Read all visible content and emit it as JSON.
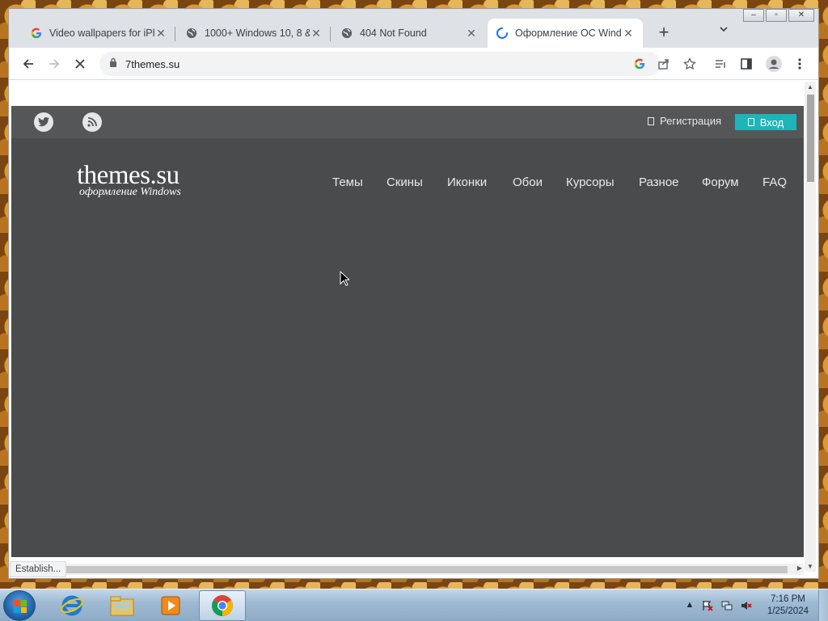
{
  "browser": {
    "tabs": [
      {
        "title": "Video wallpapers for iPh",
        "favicon": "google-g-icon",
        "active": false
      },
      {
        "title": "1000+ Windows 10, 8 &",
        "favicon": "globe-icon",
        "active": false
      },
      {
        "title": "404 Not Found",
        "favicon": "globe-icon",
        "active": false
      },
      {
        "title": "Оформление ОС Windo",
        "favicon": "loading-spinner-icon",
        "active": true
      }
    ],
    "new_tab_label": "+",
    "address": "7themes.su",
    "status_text": "Establish..."
  },
  "site": {
    "register_label": "Регистрация",
    "login_label": "Вход",
    "logo_main": "themes.su",
    "logo_sub": "оформление Windows",
    "nav": [
      "Темы",
      "Скины",
      "Иконки",
      "Обои",
      "Курсоры",
      "Разное",
      "Форум",
      "FAQ"
    ],
    "colors": {
      "topbar": "#555658",
      "main": "#4a4b4d",
      "accent": "#1fb5b8"
    }
  },
  "taskbar": {
    "time": "7:16 PM",
    "date": "1/25/2024",
    "apps": [
      "internet-explorer-icon",
      "file-explorer-icon",
      "media-player-icon",
      "chrome-icon"
    ]
  }
}
